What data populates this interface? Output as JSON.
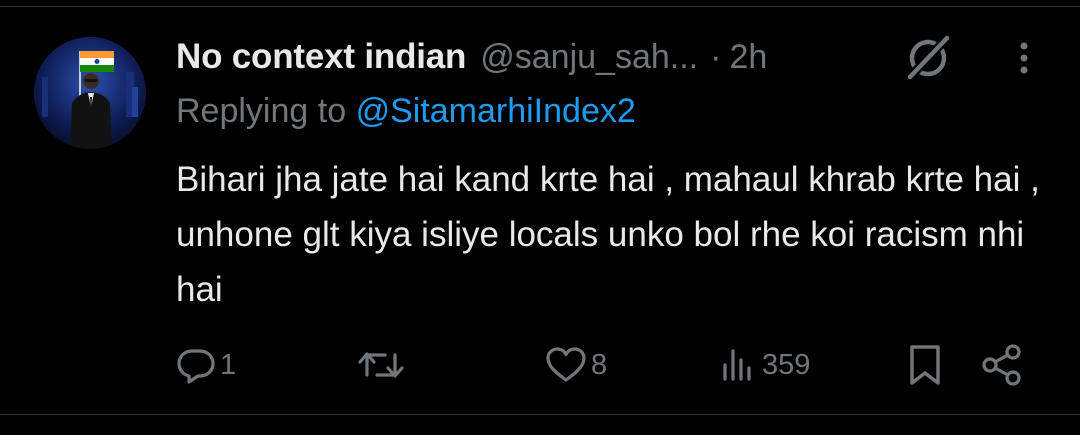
{
  "tweet": {
    "display_name": "No context indian",
    "handle": "@sanju_sah...",
    "separator": "·",
    "time": "2h",
    "replying_prefix": "Replying to",
    "replying_to": "@SitamarhiIndex2",
    "text": "Bihari jha jate hai kand krte hai , mahaul khrab krte hai , unhone glt kiya isliye locals unko bol rhe koi racism nhi hai"
  },
  "actions": {
    "replies": "1",
    "retweets": "",
    "likes": "8",
    "views": "359"
  },
  "icons": {
    "avatar": "avatar-man-with-indian-flag",
    "grok": "grok-icon",
    "more": "more-options-icon",
    "reply": "reply-icon",
    "retweet": "retweet-icon",
    "like": "like-icon",
    "views": "views-icon",
    "bookmark": "bookmark-icon",
    "share": "share-icon"
  },
  "colors": {
    "background": "#000000",
    "primary_text": "#e7e9ea",
    "secondary_text": "#71767b",
    "link": "#1d9bf0",
    "divider": "#2f3336"
  }
}
